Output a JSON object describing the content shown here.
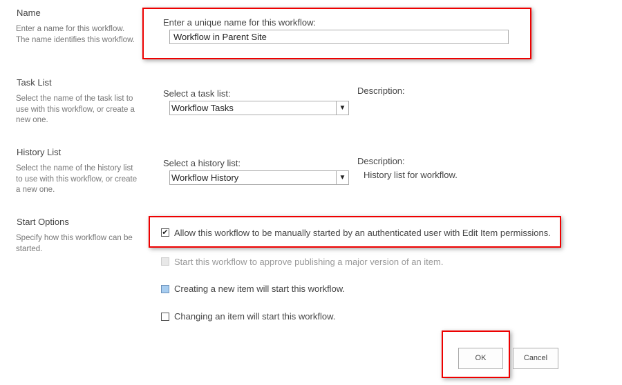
{
  "sections": {
    "name": {
      "title": "Name",
      "desc": "Enter a name for this workflow. The name identifies this workflow.",
      "field_label": "Enter a unique name for this workflow:",
      "value": "Workflow in Parent Site"
    },
    "task_list": {
      "title": "Task List",
      "desc": "Select the name of the task list to use with this workflow, or create a new one.",
      "field_label": "Select a task list:",
      "value": "Workflow Tasks",
      "description_label": "Description:"
    },
    "history_list": {
      "title": "History List",
      "desc": "Select the name of the history list to use with this workflow, or create a new one.",
      "field_label": "Select a history list:",
      "value": "Workflow History",
      "description_label": "Description:",
      "description_value": "History list for workflow."
    },
    "start_options": {
      "title": "Start Options",
      "desc": "Specify how this workflow can be started.",
      "options": [
        {
          "label": "Allow this workflow to be manually started by an authenticated user with Edit Item permissions.",
          "checked": true,
          "disabled": false
        },
        {
          "label": "Start this workflow to approve publishing a major version of an item.",
          "checked": false,
          "disabled": true
        },
        {
          "label": "Creating a new item will start this workflow.",
          "checked": false,
          "disabled": false
        },
        {
          "label": "Changing an item will start this workflow.",
          "checked": false,
          "disabled": false
        }
      ]
    }
  },
  "buttons": {
    "ok": "OK",
    "cancel": "Cancel"
  },
  "colors": {
    "highlight": "#ee0000",
    "hover_checkbox": "#a7cdf0"
  }
}
